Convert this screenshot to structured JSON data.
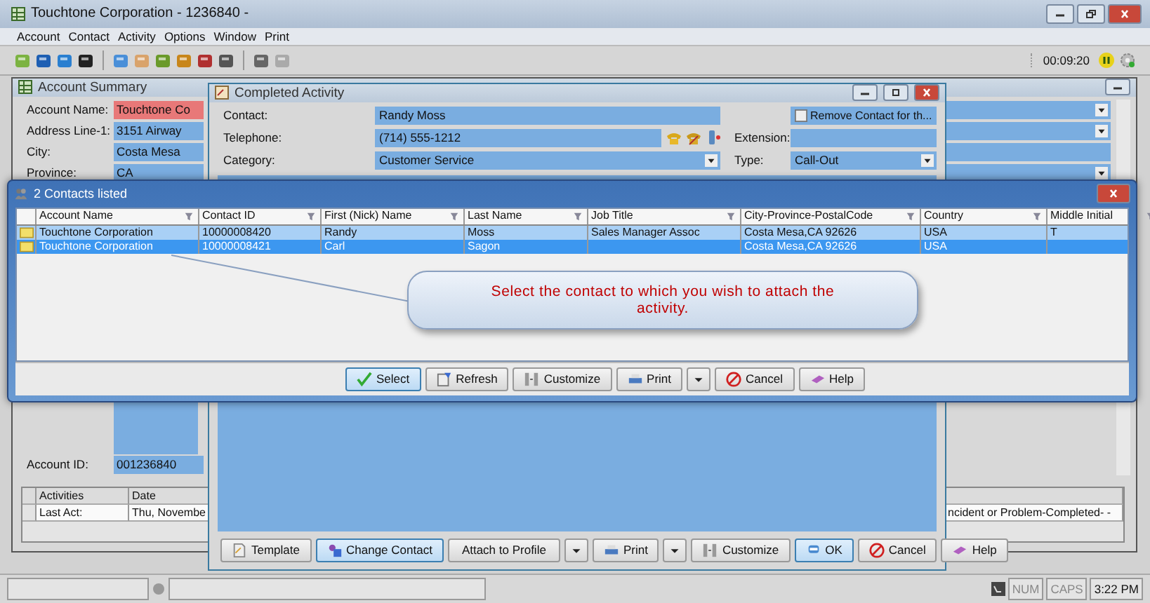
{
  "window": {
    "title": "Touchtone Corporation - 1236840 -"
  },
  "menu": [
    "Account",
    "Contact",
    "Activity",
    "Options",
    "Window",
    "Print"
  ],
  "toolbar": {
    "timer": "00:09:20"
  },
  "account_summary": {
    "title": "Account Summary",
    "fields": [
      {
        "label": "Account Name:",
        "value": "Touchtone Co",
        "alert": true
      },
      {
        "label": "Address Line-1:",
        "value": "3151 Airway",
        "alert": false
      },
      {
        "label": "City:",
        "value": "Costa Mesa",
        "alert": false
      },
      {
        "label": "Province:",
        "value": "CA",
        "alert": false
      }
    ],
    "account_id": {
      "label": "Account ID:",
      "value": "001236840"
    },
    "activities": {
      "columns": [
        "Activities",
        "Date"
      ],
      "row": [
        "Last Act:",
        "Thu, Novembe"
      ],
      "detail": "ncident or Problem-Completed- -"
    }
  },
  "completed_activity": {
    "title": "Completed Activity",
    "contact": {
      "label": "Contact:",
      "value": "Randy Moss"
    },
    "remove_contact": {
      "label": "Remove Contact for th...",
      "checked": false
    },
    "telephone": {
      "label": "Telephone:",
      "value": "(714) 555-1212"
    },
    "extension": {
      "label": "Extension:"
    },
    "category": {
      "label": "Category:",
      "value": "Customer Service"
    },
    "type": {
      "label": "Type:",
      "value": "Call-Out"
    },
    "buttons": [
      {
        "label": "Template",
        "kind": "template",
        "default": false
      },
      {
        "label": "Change Contact",
        "kind": "contact",
        "default": true
      },
      {
        "label": "Attach to Profile",
        "kind": "plain",
        "default": false
      },
      {
        "kind": "dropdown",
        "default": false
      },
      {
        "label": "Print",
        "kind": "print",
        "default": false
      },
      {
        "kind": "dropdown",
        "default": false
      },
      {
        "label": "Customize",
        "kind": "customize",
        "default": false
      },
      {
        "label": "OK",
        "kind": "ok",
        "default": true
      },
      {
        "label": "Cancel",
        "kind": "cancel",
        "default": false
      },
      {
        "label": "Help",
        "kind": "help",
        "default": false
      }
    ]
  },
  "contacts_dialog": {
    "title": "2 Contacts listed",
    "columns": [
      "Account Name",
      "Contact ID",
      "First (Nick) Name",
      "Last Name",
      "Job Title",
      "City-Province-PostalCode",
      "Country",
      "Middle Initial"
    ],
    "rows": [
      {
        "cells": [
          "Touchtone Corporation",
          "10000008420",
          "Randy",
          "Moss",
          "Sales Manager Assoc",
          "Costa Mesa,CA 92626",
          "USA",
          "T"
        ],
        "selected": false
      },
      {
        "cells": [
          "Touchtone Corporation",
          "10000008421",
          "Carl",
          "Sagon",
          "",
          "Costa Mesa,CA 92626",
          "USA",
          ""
        ],
        "selected": true
      }
    ],
    "callout": "Select the contact to which you wish to attach the activity.",
    "buttons": [
      {
        "label": "Select",
        "kind": "select",
        "default": true
      },
      {
        "label": "Refresh",
        "kind": "refresh",
        "default": false
      },
      {
        "label": "Customize",
        "kind": "customize",
        "default": false
      },
      {
        "label": "Print",
        "kind": "print",
        "default": false
      },
      {
        "kind": "dropdown",
        "default": false
      },
      {
        "label": "Cancel",
        "kind": "cancel",
        "default": false
      },
      {
        "label": "Help",
        "kind": "help",
        "default": false
      }
    ]
  },
  "status_bar": {
    "num": "NUM",
    "caps": "CAPS",
    "time": "3:22 PM"
  }
}
